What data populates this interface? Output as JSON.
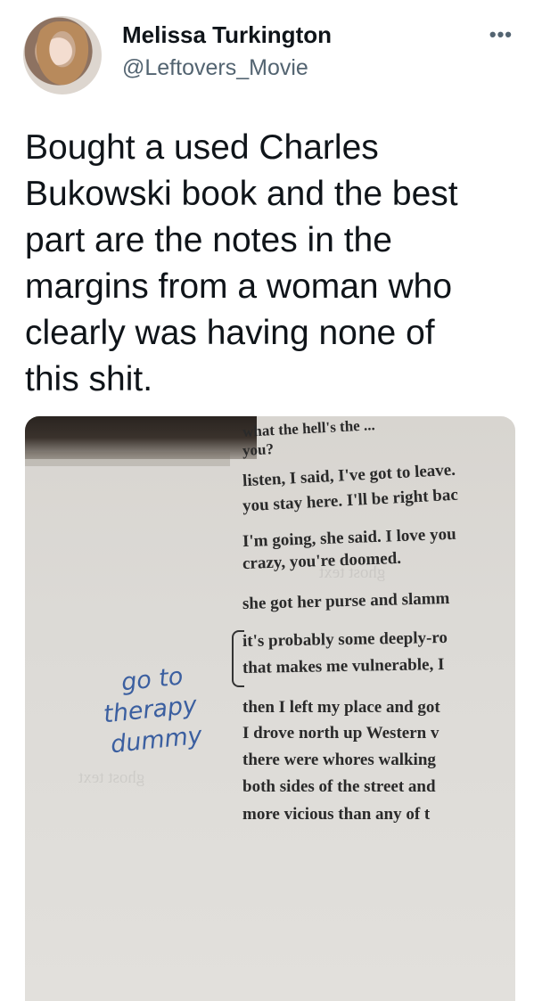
{
  "tweet": {
    "display_name": "Melissa Turkington",
    "handle": "@Leftovers_Movie",
    "more_icon": "•••",
    "text_lines": [
      "Bought a used Charles",
      "Bukowski book and the best",
      "part are the notes in the",
      "margins from a woman who",
      "clearly was having none of",
      "this shit."
    ]
  },
  "photo": {
    "book_lines": [
      "what the hell's the ...",
      "you?",
      "listen, I said, I've got to leave.",
      "you stay here. I'll be right bac",
      "I'm going, she said. I love you",
      "crazy, you're doomed.",
      "she got her purse and slamm",
      "it's probably some deeply-ro",
      "that makes me vulnerable, I",
      "then I left my place and got",
      "I drove north up Western v",
      "there were whores walking",
      "both sides of the street and",
      "more vicious than any of t"
    ],
    "handwriting": [
      "go to",
      "therapy",
      "dummy"
    ]
  }
}
